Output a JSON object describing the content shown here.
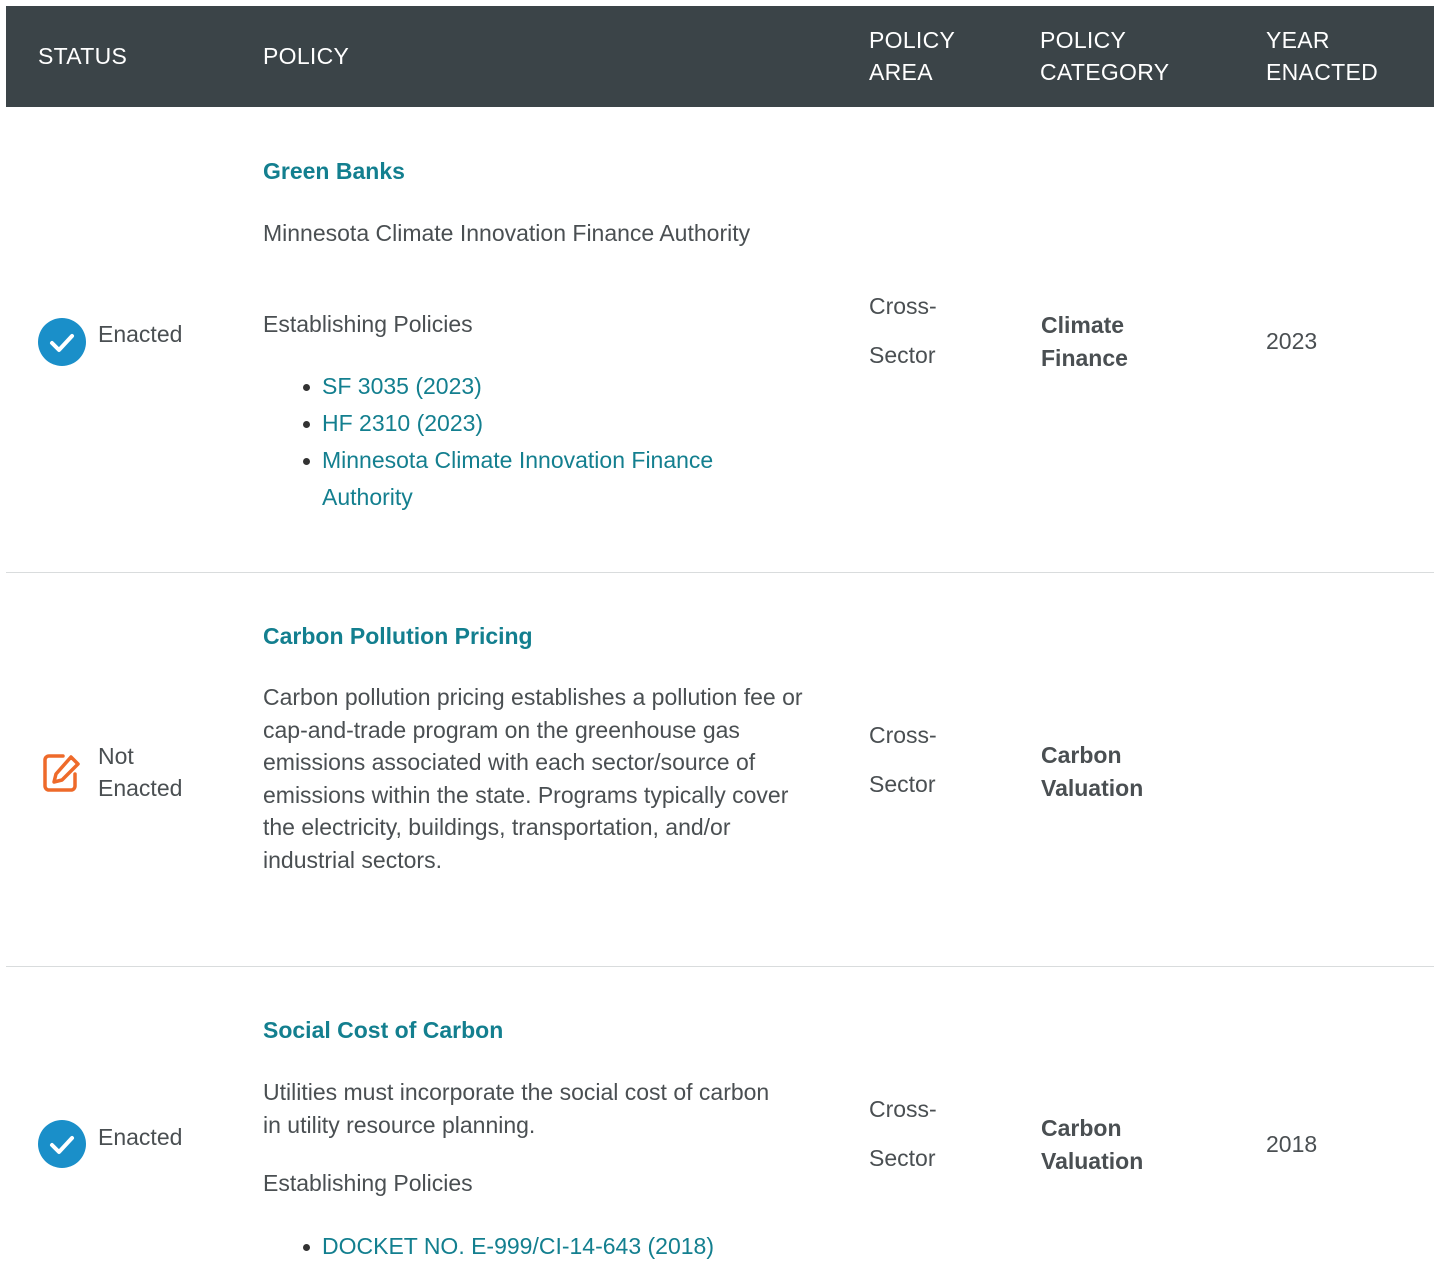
{
  "header": {
    "status": "STATUS",
    "policy": "POLICY",
    "policy_area_1": "POLICY",
    "policy_area_2": "AREA",
    "policy_category_1": "POLICY",
    "policy_category_2": "CATEGORY",
    "year_enacted_1": "YEAR",
    "year_enacted_2": "ENACTED"
  },
  "rows": [
    {
      "status": "Enacted",
      "status_icon": "check-circle-icon",
      "title": "Green Banks",
      "description": "Minnesota Climate Innovation Finance Authority",
      "establishing_label": "Establishing Policies",
      "links": [
        "SF 3035 (2023)",
        "HF 2310 (2023)",
        "Minnesota Climate Innovation Finance Authority"
      ],
      "area_1": "Cross-",
      "area_2": "Sector",
      "category": "Climate Finance",
      "year": "2023"
    },
    {
      "status_1": "Not",
      "status_2": "Enacted",
      "status_icon": "edit-icon",
      "title": "Carbon Pollution Pricing",
      "description": "Carbon pollution pricing establishes a pollution fee or cap-and-trade program on the greenhouse gas emissions associated with each sector/source of emissions within the state. Programs typically cover the electricity, buildings, transportation, and/or industrial sectors.",
      "area_1": "Cross-",
      "area_2": "Sector",
      "category": "Carbon Valuation"
    },
    {
      "status": "Enacted",
      "status_icon": "check-circle-icon",
      "title": "Social Cost of Carbon",
      "description": "Utilities must incorporate the social cost of carbon in utility resource planning.",
      "establishing_label": "Establishing Policies",
      "links": [
        "DOCKET NO. E-999/CI-14-643 (2018)"
      ],
      "area_1": "Cross-",
      "area_2": "Sector",
      "category": "Carbon Valuation",
      "year": "2018"
    }
  ],
  "colors": {
    "header_bg": "#3b4448",
    "link": "#137f8f",
    "check": "#1a8fc9",
    "edit": "#ee6a2a"
  }
}
